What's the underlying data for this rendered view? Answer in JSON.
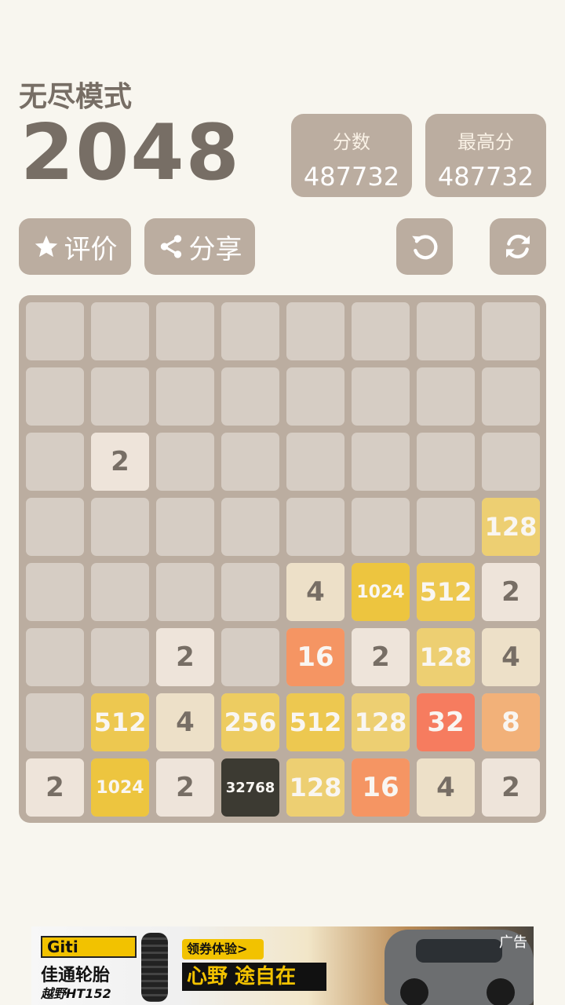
{
  "header": {
    "mode": "无尽模式",
    "title": "2048"
  },
  "scores": {
    "score_label": "分数",
    "score_value": "487732",
    "best_label": "最高分",
    "best_value": "487732"
  },
  "buttons": {
    "rate_label": "评价",
    "rate_icon": "star-icon",
    "share_label": "分享",
    "share_icon": "share-icon",
    "undo_icon": "undo-icon",
    "restart_icon": "refresh-icon"
  },
  "board": {
    "size": 8,
    "tiles": [
      [
        "",
        "",
        "",
        "",
        "",
        "",
        "",
        ""
      ],
      [
        "",
        "",
        "",
        "",
        "",
        "",
        "",
        ""
      ],
      [
        "",
        "2",
        "",
        "",
        "",
        "",
        "",
        ""
      ],
      [
        "",
        "",
        "",
        "",
        "",
        "",
        "",
        "128"
      ],
      [
        "",
        "",
        "",
        "",
        "4",
        "1024",
        "512",
        "2"
      ],
      [
        "",
        "",
        "2",
        "",
        "16",
        "2",
        "128",
        "4"
      ],
      [
        "",
        "512",
        "4",
        "256",
        "512",
        "128",
        "32",
        "8"
      ],
      [
        "2",
        "1024",
        "2",
        "32768",
        "128",
        "16",
        "4",
        "2"
      ]
    ]
  },
  "ad": {
    "brand": "Giti",
    "brand_cn": "佳通轮胎",
    "model": "越野HT152",
    "cta": "领券体验>",
    "slogan": "心野 途自在",
    "label": "广告"
  }
}
